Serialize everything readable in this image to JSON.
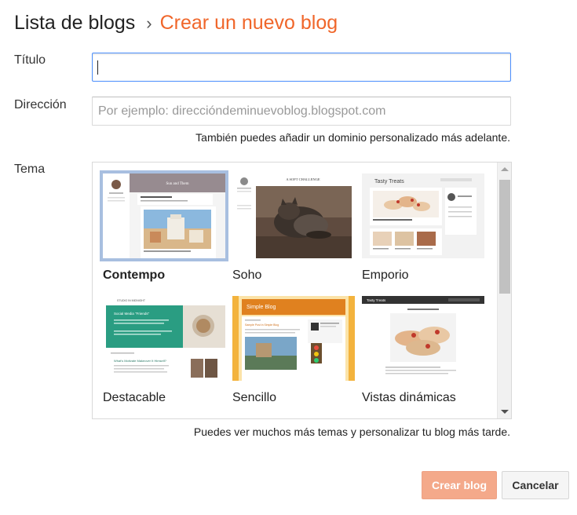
{
  "header": {
    "breadcrumb_root": "Lista de blogs",
    "separator": "›",
    "current": "Crear un nuevo blog"
  },
  "form": {
    "title_label": "Título",
    "title_value": "",
    "address_label": "Dirección",
    "address_placeholder": "Por ejemplo: direccióndeminuevoblog.blogspot.com",
    "address_value": "",
    "address_hint": "También puedes añadir un dominio personalizado más adelante.",
    "theme_label": "Tema",
    "themes_footnote": "Puedes ver muchos más temas y personalizar tu blog más tarde."
  },
  "themes": [
    {
      "name": "Contempo",
      "selected": true
    },
    {
      "name": "Soho",
      "selected": false
    },
    {
      "name": "Emporio",
      "selected": false
    },
    {
      "name": "Destacable",
      "selected": false
    },
    {
      "name": "Sencillo",
      "selected": false
    },
    {
      "name": "Vistas dinámicas",
      "selected": false
    }
  ],
  "thumb_text": {
    "contempo_title": "Sun and Them",
    "soho_title": "A SOFT CHALLENGE",
    "emporio_title": "Tasty Treats",
    "destacable_head": "STUDIO IN MIDNIGHT",
    "destacable_post": "Social Media \"Friends\"",
    "destacable_post2": "What's Motivate Makeover It Himself?",
    "sencillo_title": "Simple Blog",
    "sencillo_post": "Sample Post in Simple Blog",
    "vistas_title": "Tasty Treats"
  },
  "buttons": {
    "create": "Crear blog",
    "cancel": "Cancelar"
  },
  "colors": {
    "accent": "#f0662a",
    "focus_border": "#4d90fe",
    "create_button": "#f4a98a",
    "selected_theme_border": "#a8bfe0"
  }
}
